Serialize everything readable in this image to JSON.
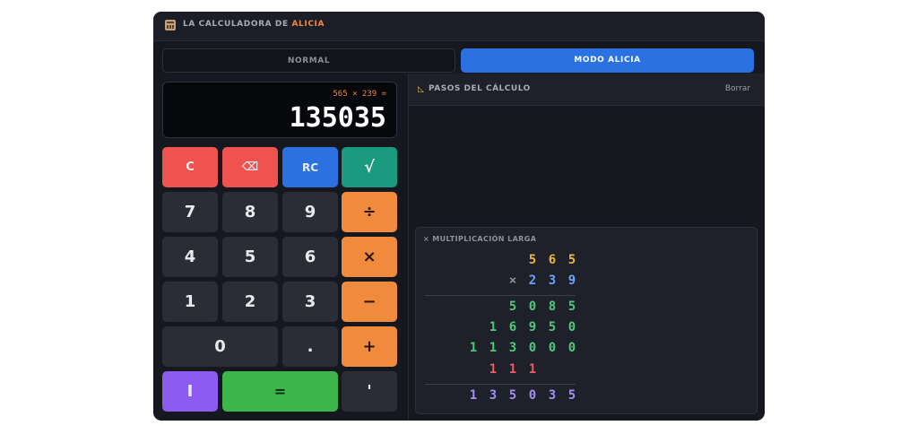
{
  "app": {
    "title_prefix": "LA CALCULADORA DE ",
    "title_accent": "ALICIA",
    "icon": "abacus-icon"
  },
  "tabs": [
    {
      "label": "NORMAL",
      "active": false
    },
    {
      "label": "MODO ALICIA",
      "active": true
    }
  ],
  "display": {
    "expression": "565 × 239 =",
    "result": "135035"
  },
  "keypad": {
    "clear": "C",
    "backspace": "⌫",
    "rc": "RC",
    "sqrt": "√",
    "divide": "÷",
    "multiply": "×",
    "minus": "−",
    "plus": "+",
    "equals": "=",
    "decimal": ".",
    "bar": "I",
    "apostrophe": "'",
    "digits": [
      "0",
      "1",
      "2",
      "3",
      "4",
      "5",
      "6",
      "7",
      "8",
      "9"
    ]
  },
  "steps": {
    "icon": "ruler-icon",
    "title": "PASOS DEL CÁLCULO",
    "clear_label": "Borrar"
  },
  "long_multiplication": {
    "title": "× MULTIPLICACIÓN LARGA",
    "multiplicand": "565",
    "operator": "×",
    "multiplier": "239",
    "partials": [
      "5085",
      "16950",
      "113000"
    ],
    "carries": "111",
    "result": "135035"
  },
  "colors": {
    "accent_orange": "#f0883e",
    "accent_blue": "#2b72e0",
    "red": "#ef5350",
    "teal": "#1a9a7e",
    "purple": "#8e5bf0",
    "green": "#3cb54a"
  }
}
